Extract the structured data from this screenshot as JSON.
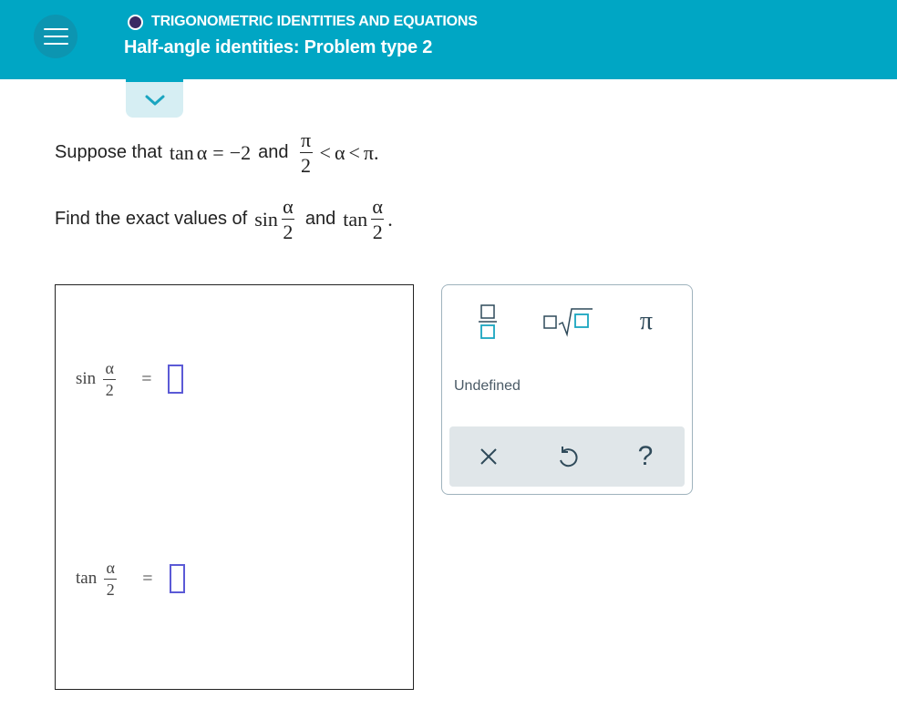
{
  "header": {
    "topic": "TRIGONOMETRIC IDENTITIES AND EQUATIONS",
    "title": "Half-angle identities: Problem type 2",
    "menu_icon": "hamburger-menu-icon",
    "collapse_icon": "chevron-down-icon"
  },
  "problem": {
    "line1": {
      "suppose": "Suppose that",
      "tan": "tan",
      "alpha": "α",
      "equals": "=",
      "value": "−2",
      "and": "and",
      "pi": "π",
      "two": "2",
      "lt1": "<",
      "alpha2": "α",
      "lt2": "<",
      "pi_end": "π."
    },
    "line2": {
      "find": "Find the exact values of",
      "sin": "sin",
      "alpha_num1": "α",
      "den1": "2",
      "and": "and",
      "tan": "tan",
      "alpha_num2": "α",
      "den2": "2",
      "period": "."
    }
  },
  "answers": [
    {
      "fn": "sin",
      "num": "α",
      "den": "2",
      "eq": "="
    },
    {
      "fn": "tan",
      "num": "α",
      "den": "2",
      "eq": "="
    }
  ],
  "palette": {
    "buttons": [
      {
        "name": "fraction-icon"
      },
      {
        "name": "nth-root-icon"
      },
      {
        "name": "pi-icon",
        "glyph": "π"
      }
    ],
    "undefined_label": "Undefined",
    "actions": [
      {
        "name": "clear-icon"
      },
      {
        "name": "undo-icon"
      },
      {
        "name": "help-icon",
        "glyph": "?"
      }
    ]
  },
  "colors": {
    "header_bg": "#00a6c4",
    "accent_teal": "#1aa5c0",
    "input_border": "#5b5ad6",
    "action_bar_bg": "#e0e6e9"
  }
}
